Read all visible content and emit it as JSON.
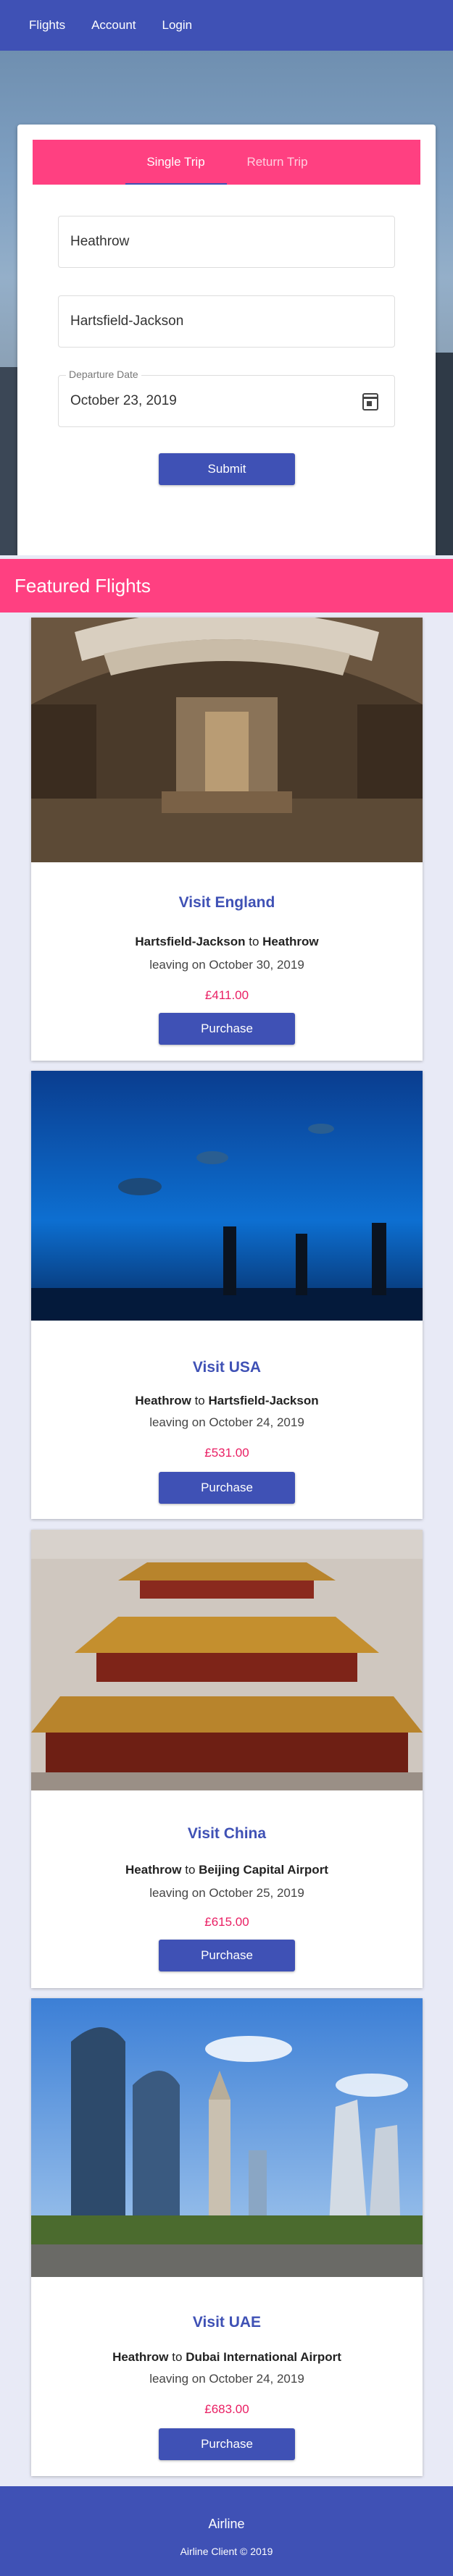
{
  "nav": {
    "items": [
      "Flights",
      "Account",
      "Login"
    ]
  },
  "search": {
    "tabs": [
      "Single Trip",
      "Return Trip"
    ],
    "from_value": "Heathrow",
    "to_value": "Hartsfield-Jackson",
    "date_label": "Departure Date",
    "date_value": "October 23, 2019",
    "submit_label": "Submit"
  },
  "featured": {
    "heading": "Featured Flights",
    "flights": [
      {
        "title": "Visit England",
        "from": "Hartsfield-Jackson",
        "to": "Heathrow",
        "leaving": "leaving on October 30, 2019",
        "price": "£411.00",
        "button": "Purchase"
      },
      {
        "title": "Visit USA",
        "from": "Heathrow",
        "to": "Hartsfield-Jackson",
        "leaving": "leaving on October 24, 2019",
        "price": "£531.00",
        "button": "Purchase"
      },
      {
        "title": "Visit China",
        "from": "Heathrow",
        "to": "Beijing Capital Airport",
        "leaving": "leaving on October 25, 2019",
        "price": "£615.00",
        "button": "Purchase"
      },
      {
        "title": "Visit UAE",
        "from": "Heathrow",
        "to": "Dubai International Airport",
        "leaving": "leaving on October 24, 2019",
        "price": "£683.00",
        "button": "Purchase"
      }
    ],
    "connector": "to"
  },
  "footer": {
    "brand": "Airline",
    "copyright": "Airline Client © 2019"
  },
  "colors": {
    "primary": "#3f51b5",
    "accent": "#ff4081",
    "price": "#e91e63",
    "background": "#e8eaf6"
  },
  "icons": [
    "calendar-icon"
  ]
}
